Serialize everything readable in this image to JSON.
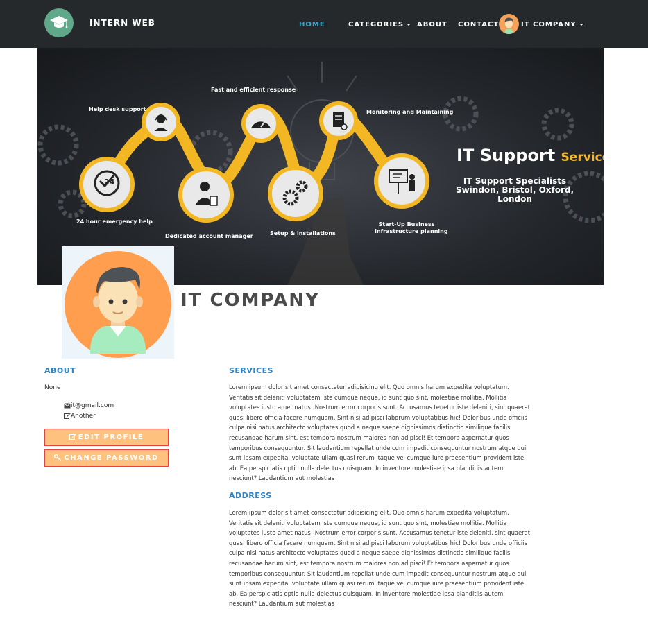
{
  "navbar": {
    "brand": "INTERN WEB",
    "items": [
      {
        "label": "HOME",
        "active": true
      },
      {
        "label": "CATEGORIES",
        "dropdown": true
      },
      {
        "label": "ABOUT"
      },
      {
        "label": "CONTACT"
      }
    ],
    "user_label": "IT COMPANY",
    "active_color": "#39a9c9",
    "bg_color": "#25292c"
  },
  "banner": {
    "labels": {
      "help_desk": "Help desk support",
      "fast": "Fast and efficient response",
      "monitoring": "Monitoring and Maintaining",
      "emergency": "24 hour emergency help",
      "dedicated": "Dedicated account manager",
      "setup": "Setup & installations",
      "startup_1": "Start-Up Business",
      "startup_2": "Infrastructure planning"
    },
    "badge_24": "24",
    "title_main": "IT Support",
    "title_accent": "Services",
    "subtitle_1": "IT Support Specialists",
    "subtitle_2": "Swindon, Bristol, Oxford, London",
    "accent_color": "#f5b82e"
  },
  "profile": {
    "company_name": "IT COMPANY"
  },
  "about": {
    "heading": "ABOUT",
    "text": "None",
    "email": "it@gmail.com",
    "note": "Another",
    "edit_button": "EDIT PROFILE",
    "password_button": "CHANGE PASSWORD"
  },
  "services": {
    "heading": "SERVICES",
    "text": "Lorem ipsum dolor sit amet consectetur adipisicing elit. Quo omnis harum expedita voluptatum. Veritatis sit deleniti voluptatem iste cumque neque, id sunt quo sint, molestiae mollitia. Mollitia voluptates iusto amet natus! Nostrum error corporis sunt. Accusamus tenetur iste deleniti, sint quaerat quasi libero officia facere numquam. Sint nisi adipisci laborum voluptatibus hic! Doloribus unde officiis culpa nisi natus architecto voluptates quod a neque saepe dignissimos distinctio similique facilis recusandae harum sint, est tempora nostrum maiores non adipisci! Et tempora aspernatur quos temporibus consequuntur. Sit laudantium repellat unde cum impedit consequuntur nostrum atque qui sunt ipsam expedita, voluptate ullam quasi rerum itaque vel cumque iure praesentium provident iste ab. Ea perspiciatis optio nulla delectus quisquam. In inventore molestiae ipsa blanditiis autem nesciunt? Laudantium aut molestias"
  },
  "address": {
    "heading": "ADDRESS",
    "text": "Lorem ipsum dolor sit amet consectetur adipisicing elit. Quo omnis harum expedita voluptatum. Veritatis sit deleniti voluptatem iste cumque neque, id sunt quo sint, molestiae mollitia. Mollitia voluptates iusto amet natus! Nostrum error corporis sunt. Accusamus tenetur iste deleniti, sint quaerat quasi libero officia facere numquam. Sint nisi adipisci laborum voluptatibus hic! Doloribus unde officiis culpa nisi natus architecto voluptates quod a neque saepe dignissimos distinctio similique facilis recusandae harum sint, est tempora nostrum maiores non adipisci! Et tempora aspernatur quos temporibus consequuntur. Sit laudantium repellat unde cum impedit consequuntur nostrum atque qui sunt ipsam expedita, voluptate ullam quasi rerum itaque vel cumque iure praesentium provident iste ab. Ea perspiciatis optio nulla delectus quisquam. In inventore molestiae ipsa blanditiis autem nesciunt? Laudantium aut molestias"
  },
  "icons": [
    "graduation-cap-icon",
    "envelope-icon",
    "edit-icon",
    "key-icon",
    "headset-icon",
    "speedometer-icon",
    "checklist-icon",
    "clock-24-icon",
    "manager-icon",
    "gears-icon",
    "presentation-icon",
    "avatar"
  ]
}
